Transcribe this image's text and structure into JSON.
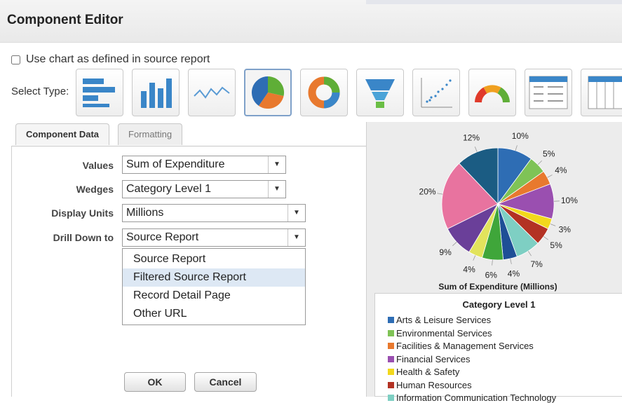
{
  "window": {
    "title": "Component Editor"
  },
  "use_chart": {
    "label": "Use chart as defined in source report",
    "checked": false
  },
  "select_type": {
    "label": "Select Type:",
    "types": [
      "horizontal-bar-icon",
      "vertical-bar-icon",
      "line-chart-icon",
      "pie-chart-icon",
      "donut-chart-icon",
      "funnel-chart-icon",
      "scatter-chart-icon",
      "gauge-chart-icon",
      "table-icon",
      "table-partial-icon"
    ],
    "selected": "pie-chart-icon"
  },
  "tabs": [
    {
      "label": "Component Data",
      "active": true
    },
    {
      "label": "Formatting",
      "active": false
    }
  ],
  "form": {
    "values_label": "Values",
    "values_value": "Sum of Expenditure",
    "wedges_label": "Wedges",
    "wedges_value": "Category Level 1",
    "display_units_label": "Display Units",
    "display_units_value": "Millions",
    "drill_down_label": "Drill Down to",
    "drill_down_value": "Source Report"
  },
  "drill_down_options": [
    "Source Report",
    "Filtered Source Report",
    "Record Detail Page",
    "Other URL"
  ],
  "drill_down_highlighted": "Filtered Source Report",
  "buttons": {
    "ok": "OK",
    "cancel": "Cancel"
  },
  "chart_data": {
    "type": "pie",
    "title": "Sum of Expenditure (Millions)",
    "slices": [
      {
        "label": "10%",
        "value": 10,
        "color": "#2e6db4"
      },
      {
        "label": "5%",
        "value": 5,
        "color": "#7fc356"
      },
      {
        "label": "4%",
        "value": 4,
        "color": "#e8792e"
      },
      {
        "label": "10%",
        "value": 10,
        "color": "#9a4fb0"
      },
      {
        "label": "3%",
        "value": 3,
        "color": "#f2d81c"
      },
      {
        "label": "5%",
        "value": 5,
        "color": "#b33224"
      },
      {
        "label": "7%",
        "value": 7,
        "color": "#7ecfc3"
      },
      {
        "label": "4%",
        "value": 4,
        "color": "#1e4f96"
      },
      {
        "label": "6%",
        "value": 6,
        "color": "#3fa63a"
      },
      {
        "label": "4%",
        "value": 4,
        "color": "#e2e35c"
      },
      {
        "label": "9%",
        "value": 9,
        "color": "#6a3f99"
      },
      {
        "label": "20%",
        "value": 20,
        "color": "#e8739f"
      },
      {
        "label": "12%",
        "value": 12,
        "color": "#1b5c83"
      }
    ]
  },
  "legend": {
    "title": "Category Level 1",
    "items": [
      {
        "label": "Arts & Leisure Services",
        "color": "#2e6db4"
      },
      {
        "label": "Environmental Services",
        "color": "#7fc356"
      },
      {
        "label": "Facilities & Management Services",
        "color": "#e8792e"
      },
      {
        "label": "Financial Services",
        "color": "#9a4fb0"
      },
      {
        "label": "Health & Safety",
        "color": "#f2d81c"
      },
      {
        "label": "Human Resources",
        "color": "#b33224"
      },
      {
        "label": "Information Communication Technology",
        "color": "#7ecfc3"
      }
    ]
  }
}
